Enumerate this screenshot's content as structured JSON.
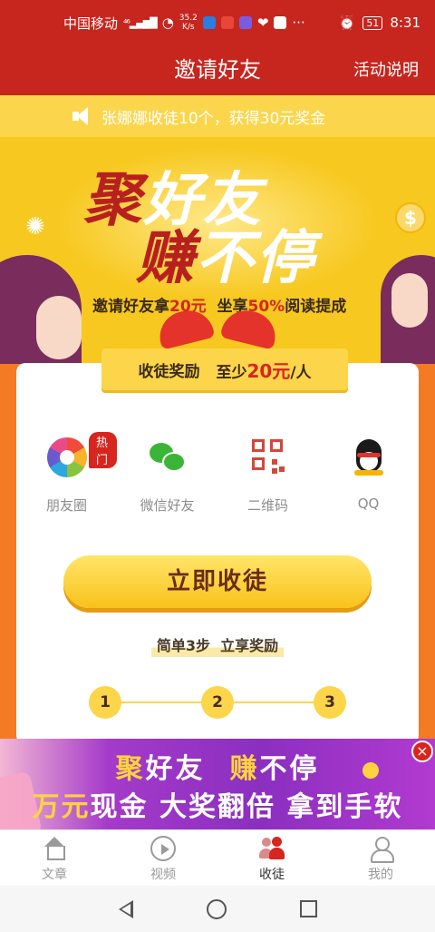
{
  "status_bar": {
    "carrier": "中国移动",
    "network": "⁴⁶",
    "speed_value": "35.2",
    "speed_unit": "K/s",
    "battery": "51",
    "time": "8:31"
  },
  "header": {
    "title": "邀请好友",
    "rules_label": "活动说明"
  },
  "notice": {
    "text": "张娜娜收徒10个，获得30元奖金"
  },
  "hero": {
    "headline_1a": "聚",
    "headline_1b": "好友",
    "headline_2a": "赚",
    "headline_2b": "不停",
    "subtitle_a": "邀请好友拿",
    "subtitle_b": "20元",
    "subtitle_c": "  坐享",
    "subtitle_d": "50%",
    "subtitle_e": "阅读提成"
  },
  "card": {
    "reward_label": "收徒奖励",
    "reward_prefix": "至少",
    "reward_amount": "20元",
    "reward_suffix": "/人",
    "share_options": [
      {
        "label": "朋友圈",
        "badge": "热门"
      },
      {
        "label": "微信好友"
      },
      {
        "label": "二维码"
      },
      {
        "label": "QQ"
      }
    ],
    "cta_label": "立即收徒",
    "steps_title": "简单3步  立享奖励",
    "steps": [
      "1",
      "2",
      "3"
    ]
  },
  "promo": {
    "line1_a": "聚",
    "line1_b": "好友  ",
    "line1_c": "赚",
    "line1_d": "不停",
    "line2_a": "万元",
    "line2_b": "现金 大奖翻倍 拿到手软",
    "close": "×"
  },
  "bottom_nav": {
    "items": [
      {
        "label": "文章",
        "icon": "home-icon"
      },
      {
        "label": "视频",
        "icon": "video-icon"
      },
      {
        "label": "收徒",
        "icon": "disciple-icon",
        "active": true
      },
      {
        "label": "我的",
        "icon": "me-icon"
      }
    ]
  },
  "colors": {
    "brand_red": "#c6261e",
    "yellow": "#fbd64c",
    "orange": "#f47a24"
  }
}
